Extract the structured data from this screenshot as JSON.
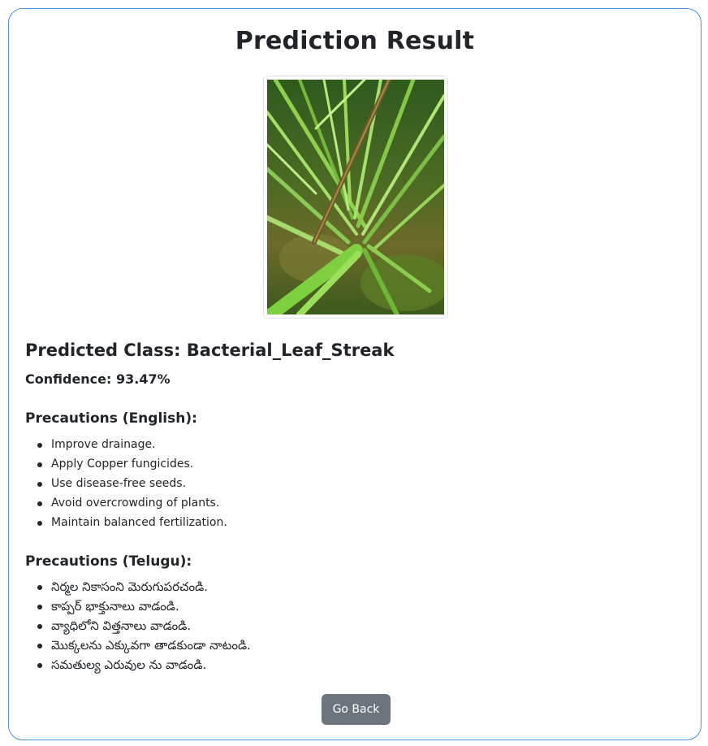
{
  "page": {
    "title": "Prediction Result"
  },
  "result": {
    "predicted_class": "Predicted Class: Bacterial_Leaf_Streak",
    "confidence": "Confidence: 93.47%"
  },
  "precautions_english": {
    "heading": "Precautions (English):",
    "items": [
      "Improve drainage.",
      "Apply Copper fungicides.",
      "Use disease-free seeds.",
      "Avoid overcrowding of plants.",
      "Maintain balanced fertilization."
    ]
  },
  "precautions_telugu": {
    "heading": "Precautions (Telugu):",
    "items": [
      "నిర్మల నికాసంని మెరుగుపరచండి.",
      "కాప్పర్ భాక్తునాలు వాడండి.",
      "వ్యాధిలోని విత్తనాలు వాడండి.",
      "మొక్కలను ఎక్కువగా తాడకుండా నాటండి.",
      "సమతుల్య ఎరువుల ను వాడండి."
    ]
  },
  "actions": {
    "back_label": "Go Back"
  },
  "colors": {
    "card_border": "#4a90d9",
    "button_bg": "#6c757d",
    "text": "#212529"
  }
}
